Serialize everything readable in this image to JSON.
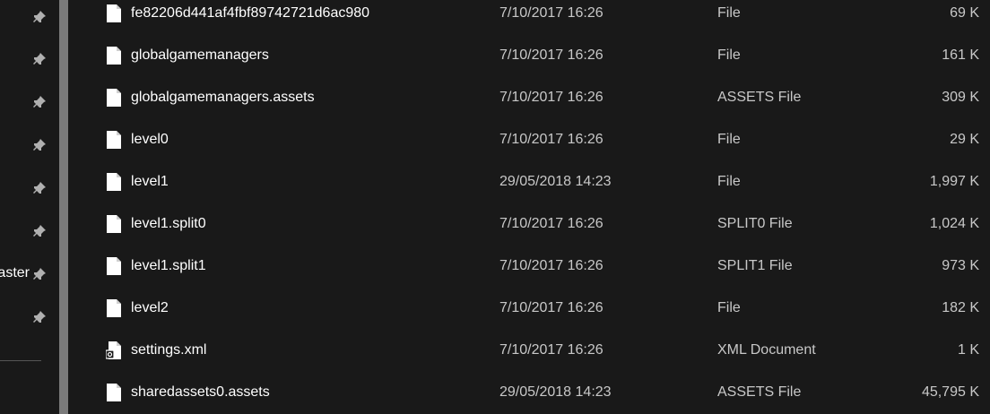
{
  "nav": {
    "items": [
      {
        "label": ""
      },
      {
        "label": ""
      },
      {
        "label": ""
      },
      {
        "label": ""
      },
      {
        "label": ""
      },
      {
        "label": ""
      },
      {
        "label": "aster"
      },
      {
        "label": ""
      }
    ]
  },
  "files": [
    {
      "name": "fe82206d441af4fbf89742721d6ac980",
      "date": "7/10/2017 16:26",
      "type": "File",
      "size": "69 K",
      "icon": "file-icon"
    },
    {
      "name": "globalgamemanagers",
      "date": "7/10/2017 16:26",
      "type": "File",
      "size": "161 K",
      "icon": "file-icon"
    },
    {
      "name": "globalgamemanagers.assets",
      "date": "7/10/2017 16:26",
      "type": "ASSETS File",
      "size": "309 K",
      "icon": "file-icon"
    },
    {
      "name": "level0",
      "date": "7/10/2017 16:26",
      "type": "File",
      "size": "29 K",
      "icon": "file-icon"
    },
    {
      "name": "level1",
      "date": "29/05/2018 14:23",
      "type": "File",
      "size": "1,997 K",
      "icon": "file-icon"
    },
    {
      "name": "level1.split0",
      "date": "7/10/2017 16:26",
      "type": "SPLIT0 File",
      "size": "1,024 K",
      "icon": "file-icon"
    },
    {
      "name": "level1.split1",
      "date": "7/10/2017 16:26",
      "type": "SPLIT1 File",
      "size": "973 K",
      "icon": "file-icon"
    },
    {
      "name": "level2",
      "date": "7/10/2017 16:26",
      "type": "File",
      "size": "182 K",
      "icon": "file-icon"
    },
    {
      "name": "settings.xml",
      "date": "7/10/2017 16:26",
      "type": "XML Document",
      "size": "1 K",
      "icon": "xml-document-icon"
    },
    {
      "name": "sharedassets0.assets",
      "date": "29/05/2018 14:23",
      "type": "ASSETS File",
      "size": "45,795 K",
      "icon": "file-icon"
    }
  ],
  "colors": {
    "background": "#191919",
    "text_primary": "#ffffff",
    "text_secondary": "#c8c8c8",
    "scrollbar_thumb": "#7a7a7a"
  }
}
